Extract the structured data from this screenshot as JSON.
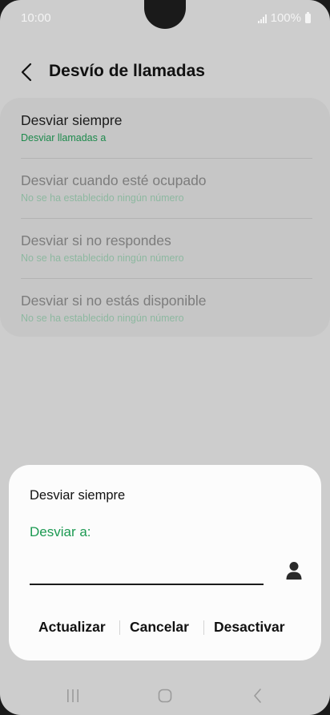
{
  "status_bar": {
    "time": "10:00",
    "battery": "100%"
  },
  "header": {
    "title": "Desvío de llamadas",
    "back_icon": "chevron-left-icon"
  },
  "forward_options": [
    {
      "title": "Desviar siempre",
      "subtitle": "Desviar llamadas a",
      "enabled": true
    },
    {
      "title": "Desviar cuando esté ocupado",
      "subtitle": "No se ha establecido ningún número",
      "enabled": false
    },
    {
      "title": "Desviar si no respondes",
      "subtitle": "No se ha establecido ningún número",
      "enabled": false
    },
    {
      "title": "Desviar si no estás disponible",
      "subtitle": "No se ha establecido ningún número",
      "enabled": false
    }
  ],
  "dialog": {
    "title": "Desviar siempre",
    "label": "Desviar a:",
    "input_value": "",
    "contact_icon": "person-icon",
    "buttons": {
      "update": "Actualizar",
      "cancel": "Cancelar",
      "deactivate": "Desactivar"
    }
  },
  "nav_bar": {
    "icons": [
      "recents-icon",
      "home-icon",
      "back-icon"
    ]
  },
  "colors": {
    "accent_green": "#1c9a52",
    "dim_background": "#cdcdcd",
    "dialog_background": "#fcfcfc"
  }
}
